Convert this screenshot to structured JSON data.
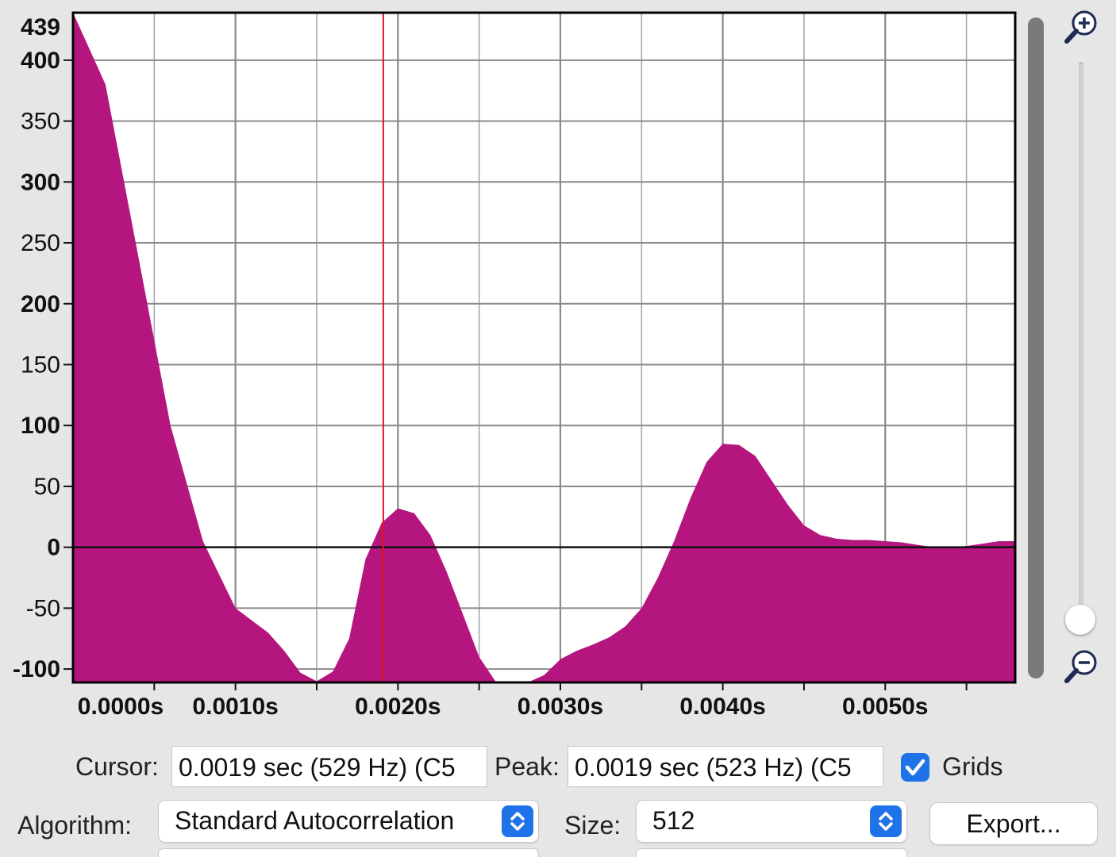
{
  "chart_data": {
    "type": "area",
    "title": "",
    "xlabel": "",
    "ylabel": "",
    "xlim": [
      0.0,
      0.0058
    ],
    "ylim": [
      -111,
      439
    ],
    "yticks": [
      {
        "label": "439",
        "value": 439
      },
      {
        "label": "400",
        "value": 400
      },
      {
        "label": "350",
        "value": 350
      },
      {
        "label": "300",
        "value": 300
      },
      {
        "label": "250",
        "value": 250
      },
      {
        "label": "200",
        "value": 200
      },
      {
        "label": "150",
        "value": 150
      },
      {
        "label": "100",
        "value": 100
      },
      {
        "label": "50",
        "value": 50
      },
      {
        "label": "0",
        "value": 0
      },
      {
        "label": "-50",
        "value": -50
      },
      {
        "label": "-100",
        "value": -100
      }
    ],
    "xticks": [
      {
        "label": "0.0000s",
        "value": 0.0
      },
      {
        "label": "0.0010s",
        "value": 0.001
      },
      {
        "label": "0.0020s",
        "value": 0.002
      },
      {
        "label": "0.0030s",
        "value": 0.003
      },
      {
        "label": "0.0040s",
        "value": 0.004
      },
      {
        "label": "0.0050s",
        "value": 0.005
      }
    ],
    "grid": true,
    "fill_color": "#b5157f",
    "cursor_color": "#e0141c",
    "cursor_x": 0.00191,
    "series": [
      {
        "x": [
          0.0,
          0.0002,
          0.0004,
          0.0006,
          0.0008,
          0.001,
          0.0011,
          0.0012,
          0.0013,
          0.0014,
          0.0015,
          0.0016,
          0.0017,
          0.0018,
          0.0019,
          0.002,
          0.0021,
          0.0022,
          0.0023,
          0.0024,
          0.0025,
          0.0026,
          0.0027,
          0.0028,
          0.0029,
          0.003,
          0.0031,
          0.0032,
          0.0033,
          0.0034,
          0.0035,
          0.0036,
          0.0037,
          0.0038,
          0.0039,
          0.004,
          0.0041,
          0.0042,
          0.0043,
          0.0044,
          0.0045,
          0.0046,
          0.0047,
          0.0048,
          0.0049,
          0.005,
          0.0051,
          0.0052,
          0.0053,
          0.0054,
          0.0055,
          0.0056,
          0.0057,
          0.0058
        ],
        "values": [
          439,
          380,
          240,
          100,
          5,
          -50,
          -60,
          -70,
          -85,
          -103,
          -110,
          -102,
          -75,
          -10,
          20,
          32,
          28,
          10,
          -20,
          -55,
          -90,
          -110,
          -112,
          -112,
          -105,
          -92,
          -85,
          -80,
          -74,
          -65,
          -50,
          -25,
          5,
          40,
          70,
          85,
          84,
          75,
          55,
          35,
          18,
          10,
          7,
          6,
          6,
          5,
          4,
          2,
          0,
          0,
          1,
          3,
          5,
          5
        ]
      }
    ]
  },
  "controls": {
    "cursor_label": "Cursor:",
    "cursor_value": "0.0019 sec (529 Hz) (C5",
    "peak_label": "Peak:",
    "peak_value": "0.0019 sec (523 Hz) (C5",
    "grids_label": "Grids",
    "grids_checked": true,
    "algorithm_label": "Algorithm:",
    "algorithm_value": "Standard Autocorrelation",
    "size_label": "Size:",
    "size_value": "512",
    "export_label": "Export..."
  },
  "icons": {
    "zoom_in": "zoom-in-icon",
    "zoom_out": "zoom-out-icon",
    "checkmark": "checkmark-icon",
    "stepper": "up-down-chevron-icon"
  },
  "colors": {
    "accent": "#1f73e8",
    "background": "#e6e6e6"
  }
}
